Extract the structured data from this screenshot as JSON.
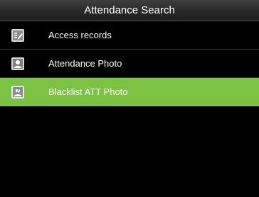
{
  "header": {
    "title": "Attendance Search"
  },
  "menu": {
    "items": [
      {
        "label": "Access records",
        "icon": "records-icon",
        "selected": false
      },
      {
        "label": "Attendance Photo",
        "icon": "photo-icon",
        "selected": false
      },
      {
        "label": "Blacklist ATT Photo",
        "icon": "blacklist-photo-icon",
        "selected": true
      }
    ]
  },
  "colors": {
    "selected_row": "#7dc343",
    "background": "#000000",
    "text": "#ffffff"
  }
}
